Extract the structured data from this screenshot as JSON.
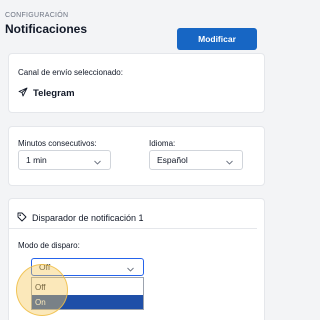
{
  "header": {
    "breadcrumb": "CONFIGURACIÓN",
    "title": "Notificaciones"
  },
  "channel_card": {
    "label": "Canal de envío seleccionado:",
    "channel": "Telegram",
    "modify_button": "Modificar"
  },
  "settings_card": {
    "minutes_label": "Minutos consecutivos:",
    "minutes_value": "1 min",
    "language_label": "Idioma:",
    "language_value": "Español"
  },
  "trigger_card": {
    "title": "Disparador de notificación 1",
    "mode_label": "Modo de disparo:",
    "mode_value": "Off",
    "options": [
      "Off",
      "On"
    ],
    "highlighted_option": "On"
  },
  "colors": {
    "accent": "#1766c4",
    "option_highlight": "#1f4fa8",
    "focus_ring": "#f5c95a"
  },
  "icons": {
    "channel": "send-icon",
    "trigger": "tag-icon",
    "chevron": "chevron-down-icon"
  }
}
